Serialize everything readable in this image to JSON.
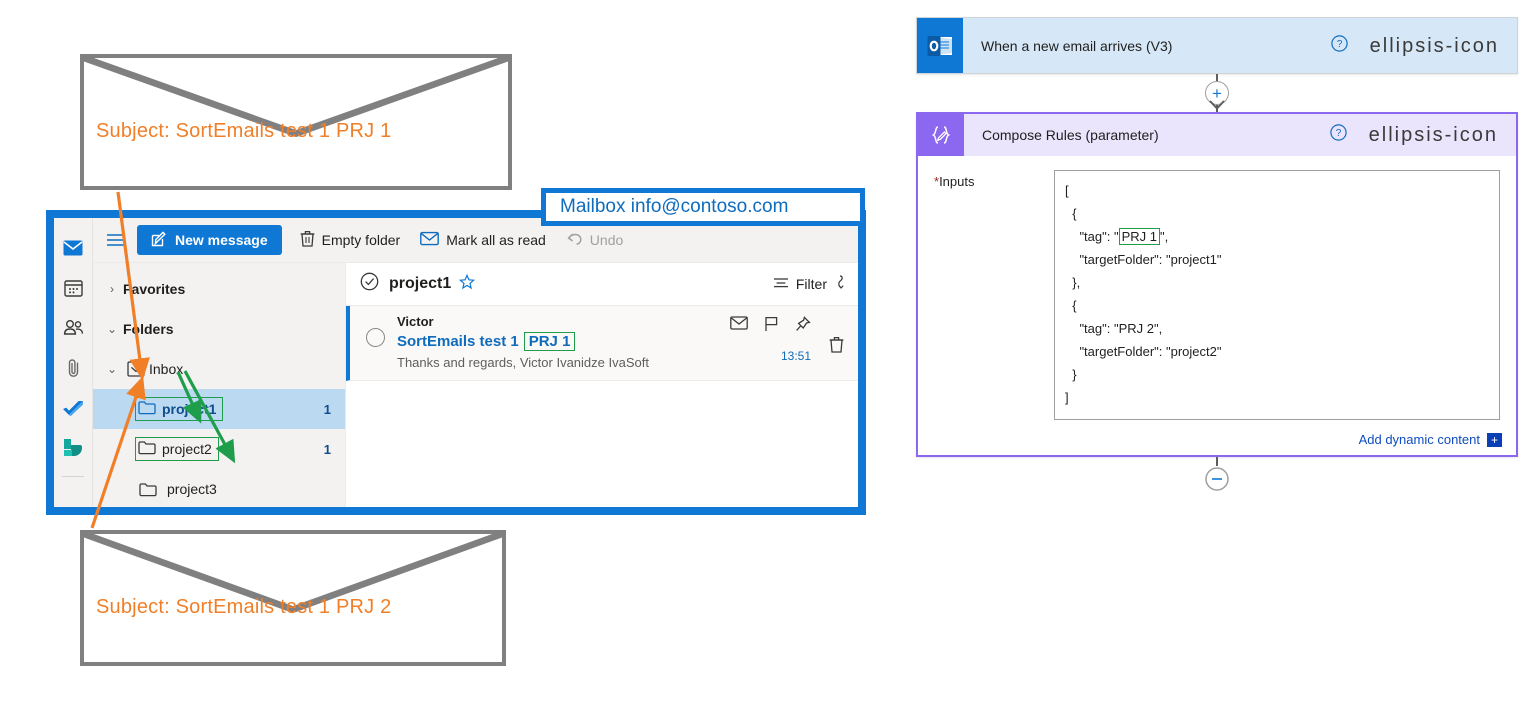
{
  "envelope_top": {
    "subject": "Subject: SortEmails test 1 PRJ 1"
  },
  "envelope_bottom": {
    "subject": "Subject: SortEmails test 1 PRJ 2"
  },
  "mailbox": {
    "label": "Mailbox  info@contoso.com",
    "rail": [
      {
        "icon": "mail-icon"
      },
      {
        "icon": "calendar-icon"
      },
      {
        "icon": "people-icon"
      },
      {
        "icon": "attachment-icon"
      },
      {
        "icon": "todo-check-icon"
      },
      {
        "icon": "bookings-icon"
      }
    ],
    "toolbar": {
      "menu_icon": "hamburger-icon",
      "new_message": "New message",
      "empty_folder": "Empty folder",
      "mark_all_as_read": "Mark all as read",
      "undo": "Undo"
    },
    "folders": [
      {
        "label": "Favorites",
        "chevron": "›",
        "icon": "",
        "count": "",
        "selected": false,
        "bold": true,
        "indent": false,
        "highlight": false
      },
      {
        "label": "Folders",
        "chevron": "⌄",
        "icon": "",
        "count": "",
        "selected": false,
        "bold": true,
        "indent": false,
        "highlight": false
      },
      {
        "label": "Inbox",
        "chevron": "⌄",
        "icon": "inbox-icon",
        "count": "",
        "selected": false,
        "bold": false,
        "indent": false,
        "highlight": false
      },
      {
        "label": "project1",
        "chevron": "",
        "icon": "folder-icon",
        "count": "1",
        "selected": true,
        "bold": false,
        "indent": true,
        "highlight": true
      },
      {
        "label": "project2",
        "chevron": "",
        "icon": "folder-icon",
        "count": "1",
        "selected": false,
        "bold": false,
        "indent": true,
        "highlight": true
      },
      {
        "label": "project3",
        "chevron": "",
        "icon": "folder-icon",
        "count": "",
        "selected": false,
        "bold": false,
        "indent": true,
        "highlight": false
      }
    ],
    "list_header": {
      "select_all_icon": "check-circle-icon",
      "title": "project1",
      "star_icon": "star-icon",
      "filter_label": "Filter",
      "filter_icon": "filter-icon",
      "sort_icon": "sort-down-icon"
    },
    "message": {
      "from": "Victor",
      "subject_main": "SortEmails test 1",
      "subject_tag": "PRJ 1",
      "preview": "Thanks and regards, Victor Ivanidze IvaSoft",
      "time": "13:51",
      "icons": [
        "unread-envelope-icon",
        "flag-icon",
        "pin-icon",
        "delete-icon"
      ]
    }
  },
  "flow": {
    "trigger": {
      "icon": "outlook-icon",
      "title": "When a new email arrives (V3)",
      "help_icon": "help-circle-icon",
      "menu_icon": "ellipsis-icon"
    },
    "connector": {
      "add_icon": "plus-icon"
    },
    "compose": {
      "icon": "compose-braces-icon",
      "title": "Compose Rules (parameter)",
      "help_icon": "help-circle-icon",
      "menu_icon": "ellipsis-icon",
      "inputs_label": "Inputs",
      "required_marker": "*",
      "code_before": "[\n  {\n    \"tag\": \"",
      "code_highlight": "PRJ 1",
      "code_after": "\",\n    \"targetFolder\": \"project1\"\n  },\n  {\n    \"tag\": \"PRJ 2\",\n    \"targetFolder\": \"project2\"\n  }\n]",
      "add_dynamic_content": "Add dynamic content",
      "add_dynamic_plus": "+"
    }
  },
  "colors": {
    "accent_blue": "#0f78d4",
    "orange": "#f07f28",
    "green": "#1e9e4a",
    "purple": "#8c68f0",
    "gray_border": "#808080"
  }
}
